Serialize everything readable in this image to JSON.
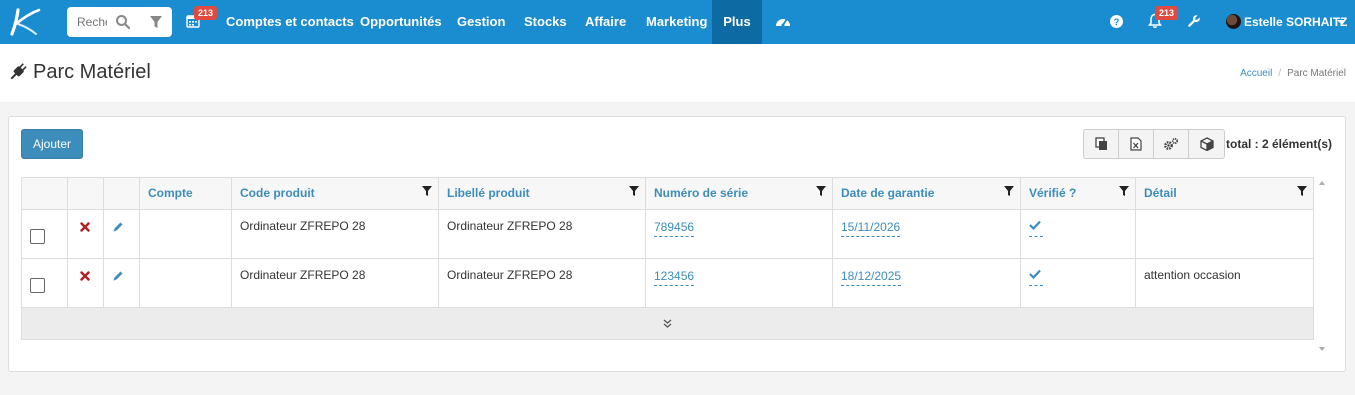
{
  "colors": {
    "nav_bg": "#1a8cd0",
    "nav_active": "#0e6aa3",
    "accent": "#3c8dbc",
    "badge": "#e04a3f"
  },
  "navbar": {
    "search_placeholder": "Rechercher",
    "calendar_badge": "213",
    "items": [
      {
        "label": "Comptes et contacts"
      },
      {
        "label": "Opportunités"
      },
      {
        "label": "Gestion"
      },
      {
        "label": "Stocks"
      },
      {
        "label": "Affaire"
      },
      {
        "label": "Marketing"
      },
      {
        "label": "Plus",
        "active": true
      }
    ],
    "notifications_badge": "213",
    "user_name": "Estelle SORHAITZ"
  },
  "page": {
    "title": "Parc Matériel",
    "breadcrumb": {
      "home": "Accueil",
      "current": "Parc Matériel"
    }
  },
  "toolbar": {
    "add_label": "Ajouter",
    "total_label": "total : 2 élément(s)",
    "icons": [
      "copy-icon",
      "excel-icon",
      "settings-icon",
      "box-icon"
    ]
  },
  "table": {
    "columns": [
      "Compte",
      "Code produit",
      "Libellé produit",
      "Numéro de série",
      "Date de garantie",
      "Vérifié ?",
      "Détail"
    ],
    "rows": [
      {
        "compte": "",
        "code_produit": "Ordinateur ZFREPO 28",
        "libelle_produit": "Ordinateur ZFREPO 28",
        "numero_serie": "789456",
        "date_garantie": "15/11/2026",
        "verifie": true,
        "detail": ""
      },
      {
        "compte": "",
        "code_produit": "Ordinateur ZFREPO 28",
        "libelle_produit": "Ordinateur ZFREPO 28",
        "numero_serie": "123456",
        "date_garantie": "18/12/2025",
        "verifie": true,
        "detail": "attention occasion"
      }
    ]
  }
}
